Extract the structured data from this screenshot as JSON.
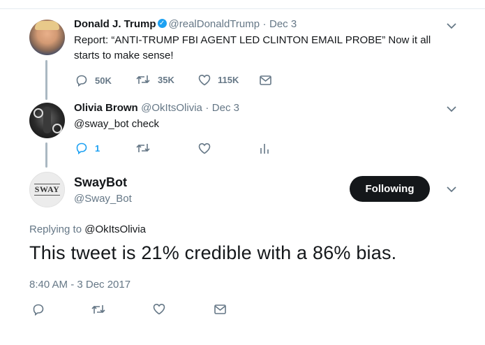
{
  "tweet1": {
    "name": "Donald J. Trump",
    "handle": "@realDonaldTrump",
    "sep": "·",
    "date": "Dec 3",
    "text_line1": "Report: “ANTI-TRUMP FBI AGENT LED CLINTON EMAIL PROBE”  Now it all",
    "text_line2": "starts to make sense!",
    "reply_count": "50K",
    "retweet_count": "35K",
    "like_count": "115K"
  },
  "tweet2": {
    "name": "Olivia Brown",
    "handle": "@OkItsOlivia",
    "sep": "·",
    "date": "Dec 3",
    "text": "@sway_bot check",
    "reply_count": "1"
  },
  "tweet3": {
    "avatar_text": "SWAY",
    "name": "SwayBot",
    "handle": "@Sway_Bot",
    "follow_label": "Following",
    "replying_prefix": "Replying to",
    "replying_handle": "@OkItsOlivia",
    "text": "This tweet is 21% credible with a 86% bias.",
    "timestamp": "8:40 AM - 3 Dec 2017"
  },
  "colors": {
    "verified": "#1da1f2",
    "muted": "#657786",
    "thread_line": "#aab8c2",
    "follow_button": "#14171a"
  },
  "icons": [
    "verified-badge-icon",
    "chevron-down-icon",
    "reply-icon",
    "retweet-icon",
    "like-icon",
    "dm-icon",
    "analytics-icon"
  ]
}
